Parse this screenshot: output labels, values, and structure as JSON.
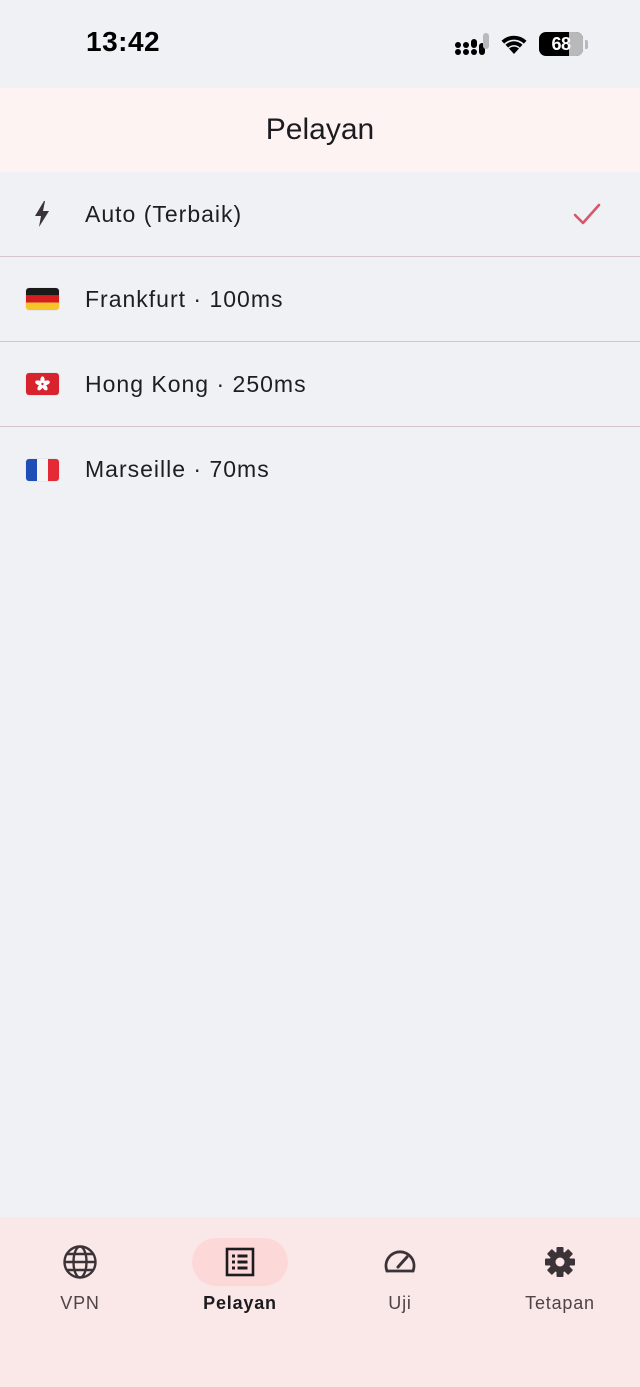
{
  "status_bar": {
    "time": "13:42",
    "battery": "68",
    "icons": [
      "signal-icon",
      "wifi-icon",
      "battery-icon"
    ]
  },
  "app_bar": {
    "title": "Pelayan"
  },
  "servers": [
    {
      "label": "Auto (Terbaik)",
      "icon": "bolt-icon",
      "selected": true
    },
    {
      "label": "Frankfurt · 100ms",
      "icon": "flag-germany-icon",
      "selected": false
    },
    {
      "label": "Hong Kong · 250ms",
      "icon": "flag-hong-kong-icon",
      "selected": false
    },
    {
      "label": "Marseille · 70ms",
      "icon": "flag-france-icon",
      "selected": false
    }
  ],
  "bottom_nav": {
    "items": [
      {
        "label": "VPN",
        "icon": "globe-icon",
        "active": false
      },
      {
        "label": "Pelayan",
        "icon": "list-icon",
        "active": true
      },
      {
        "label": "Uji",
        "icon": "speedometer-icon",
        "active": false
      },
      {
        "label": "Tetapan",
        "icon": "gear-icon",
        "active": false
      }
    ]
  },
  "colors": {
    "background": "#eff1f4",
    "app_bar": "#fdf3f2",
    "bottom_nav": "#fae8e8",
    "active_pill": "#fcd9d8",
    "check": "#d9556b",
    "divider": "#d6c6cb"
  }
}
